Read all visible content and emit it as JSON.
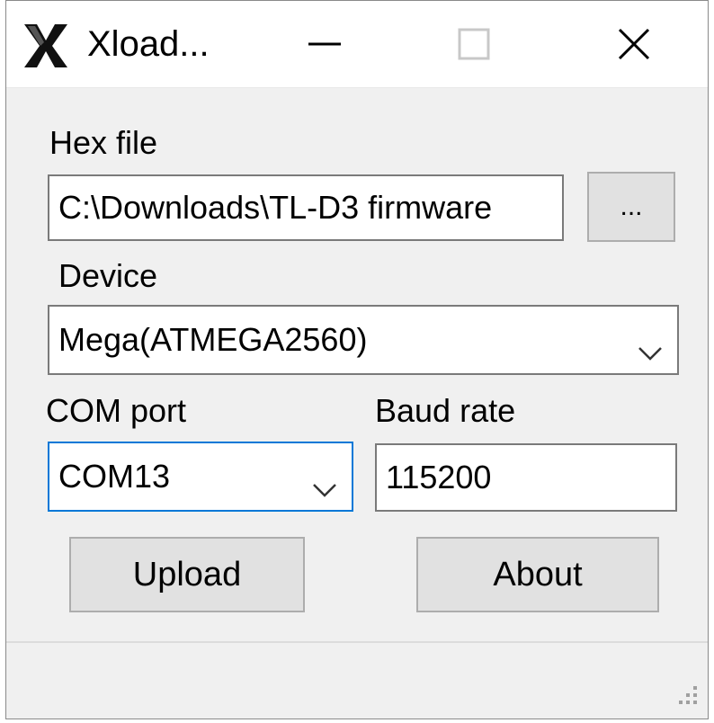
{
  "window": {
    "title": "Xload...",
    "icon": "xloader-x-icon",
    "controls": [
      "minimize-icon",
      "maximize-icon",
      "close-icon"
    ]
  },
  "hex_file": {
    "label": "Hex file",
    "value": "C:\\Downloads\\TL-D3 firmware",
    "browse_label": "..."
  },
  "device": {
    "label": "Device",
    "selected": "Mega(ATMEGA2560)"
  },
  "com_port": {
    "label": "COM port",
    "selected": "COM13"
  },
  "baud_rate": {
    "label": "Baud rate",
    "value": "115200"
  },
  "buttons": {
    "upload": "Upload",
    "about": "About"
  },
  "colors": {
    "window_bg": "#f0f0f0",
    "focus_border": "#0078d7",
    "button_bg": "#e1e1e1"
  }
}
